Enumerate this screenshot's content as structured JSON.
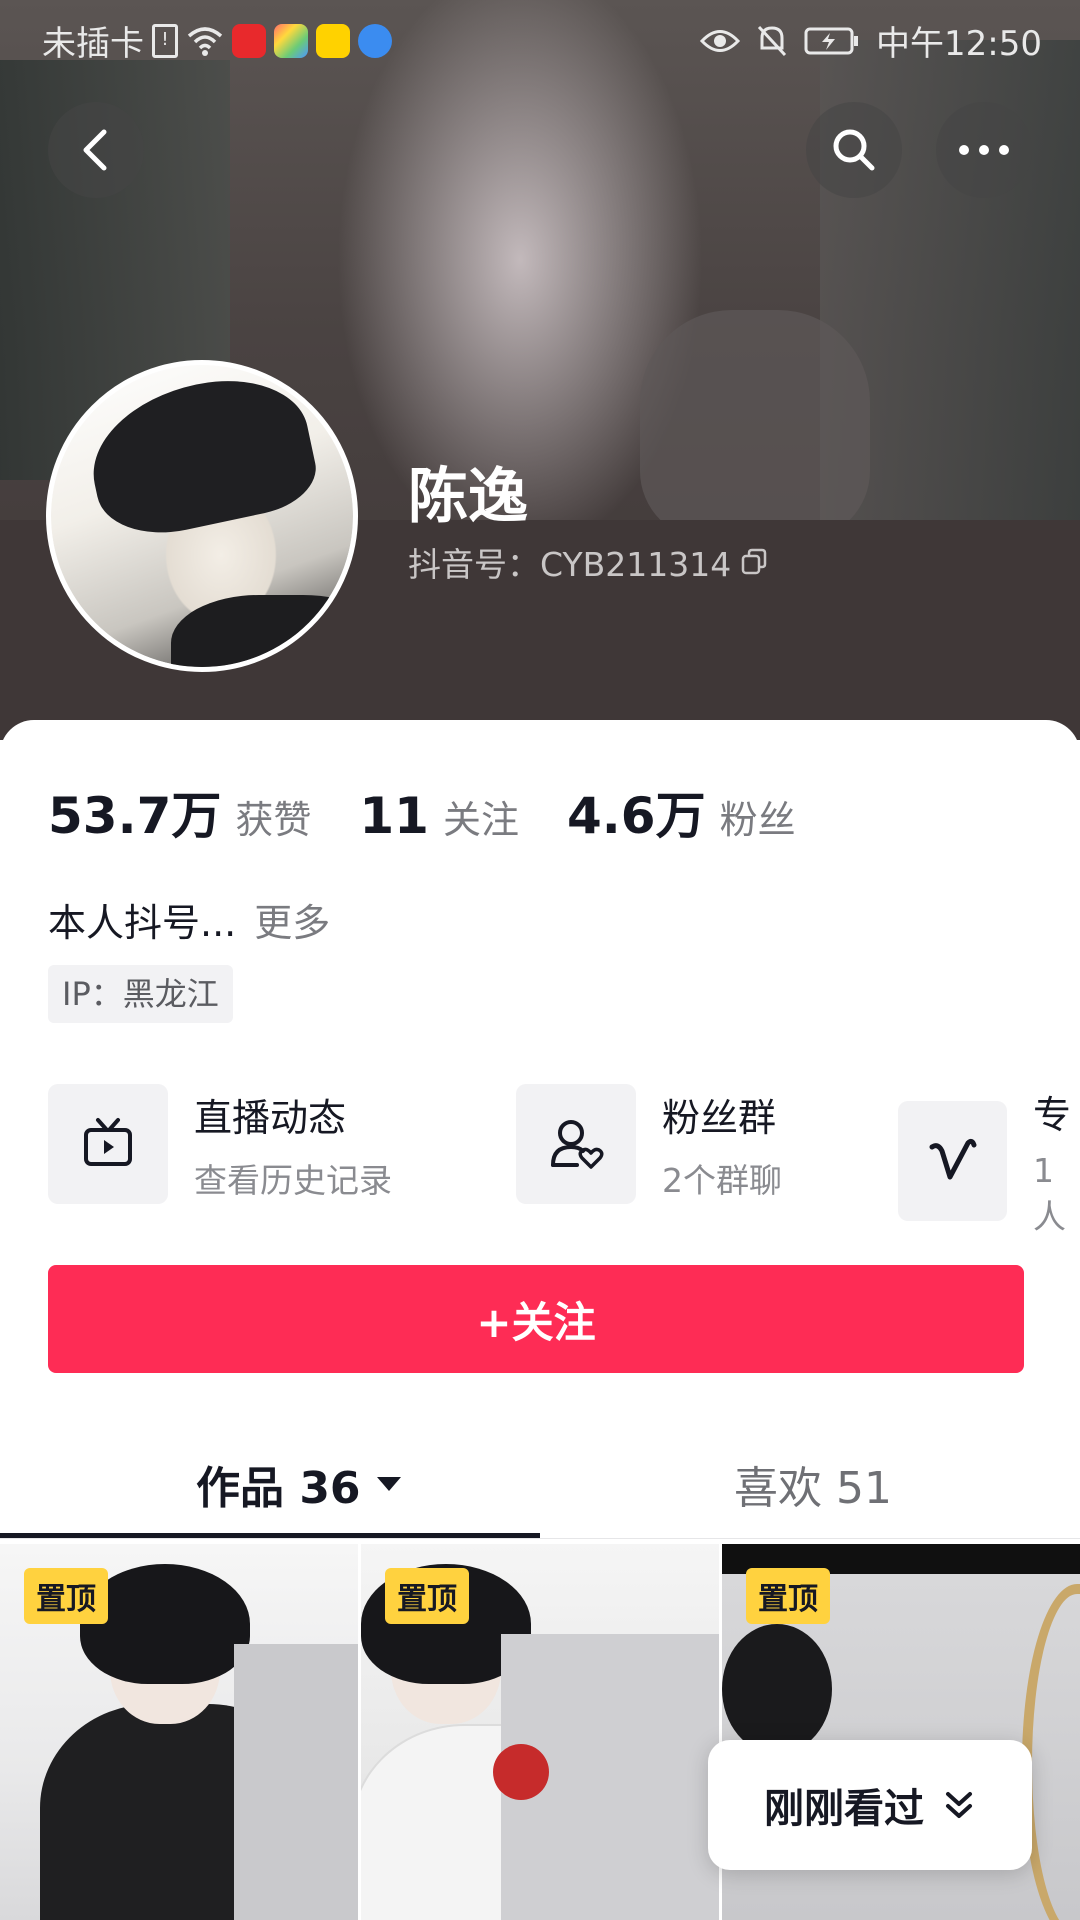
{
  "status_bar": {
    "carrier": "未插卡",
    "time": "中午12:50"
  },
  "profile": {
    "name": "陈逸",
    "account_id": "抖音号：CYB211314"
  },
  "stats": [
    {
      "value": "53.7万",
      "label": "获赞"
    },
    {
      "value": "11",
      "label": "关注"
    },
    {
      "value": "4.6万",
      "label": "粉丝"
    }
  ],
  "bio": {
    "text": "本人抖号...",
    "more": "更多",
    "ip": "IP：黑龙江"
  },
  "features": [
    {
      "title": "直播动态",
      "subtitle": "查看历史记录",
      "icon": "tv-play-icon"
    },
    {
      "title": "粉丝群",
      "subtitle": "2个群聊",
      "icon": "user-heart-icon"
    },
    {
      "title": "专",
      "subtitle": "1人",
      "icon": "v-icon"
    }
  ],
  "follow_button": "+关注",
  "tabs": {
    "works": "作品 36",
    "likes": "喜欢 51"
  },
  "grid": {
    "pin_label": "置顶"
  },
  "recent_button": "刚刚看过",
  "colors": {
    "accent": "#fe2c55",
    "pin": "#ffd23f"
  }
}
